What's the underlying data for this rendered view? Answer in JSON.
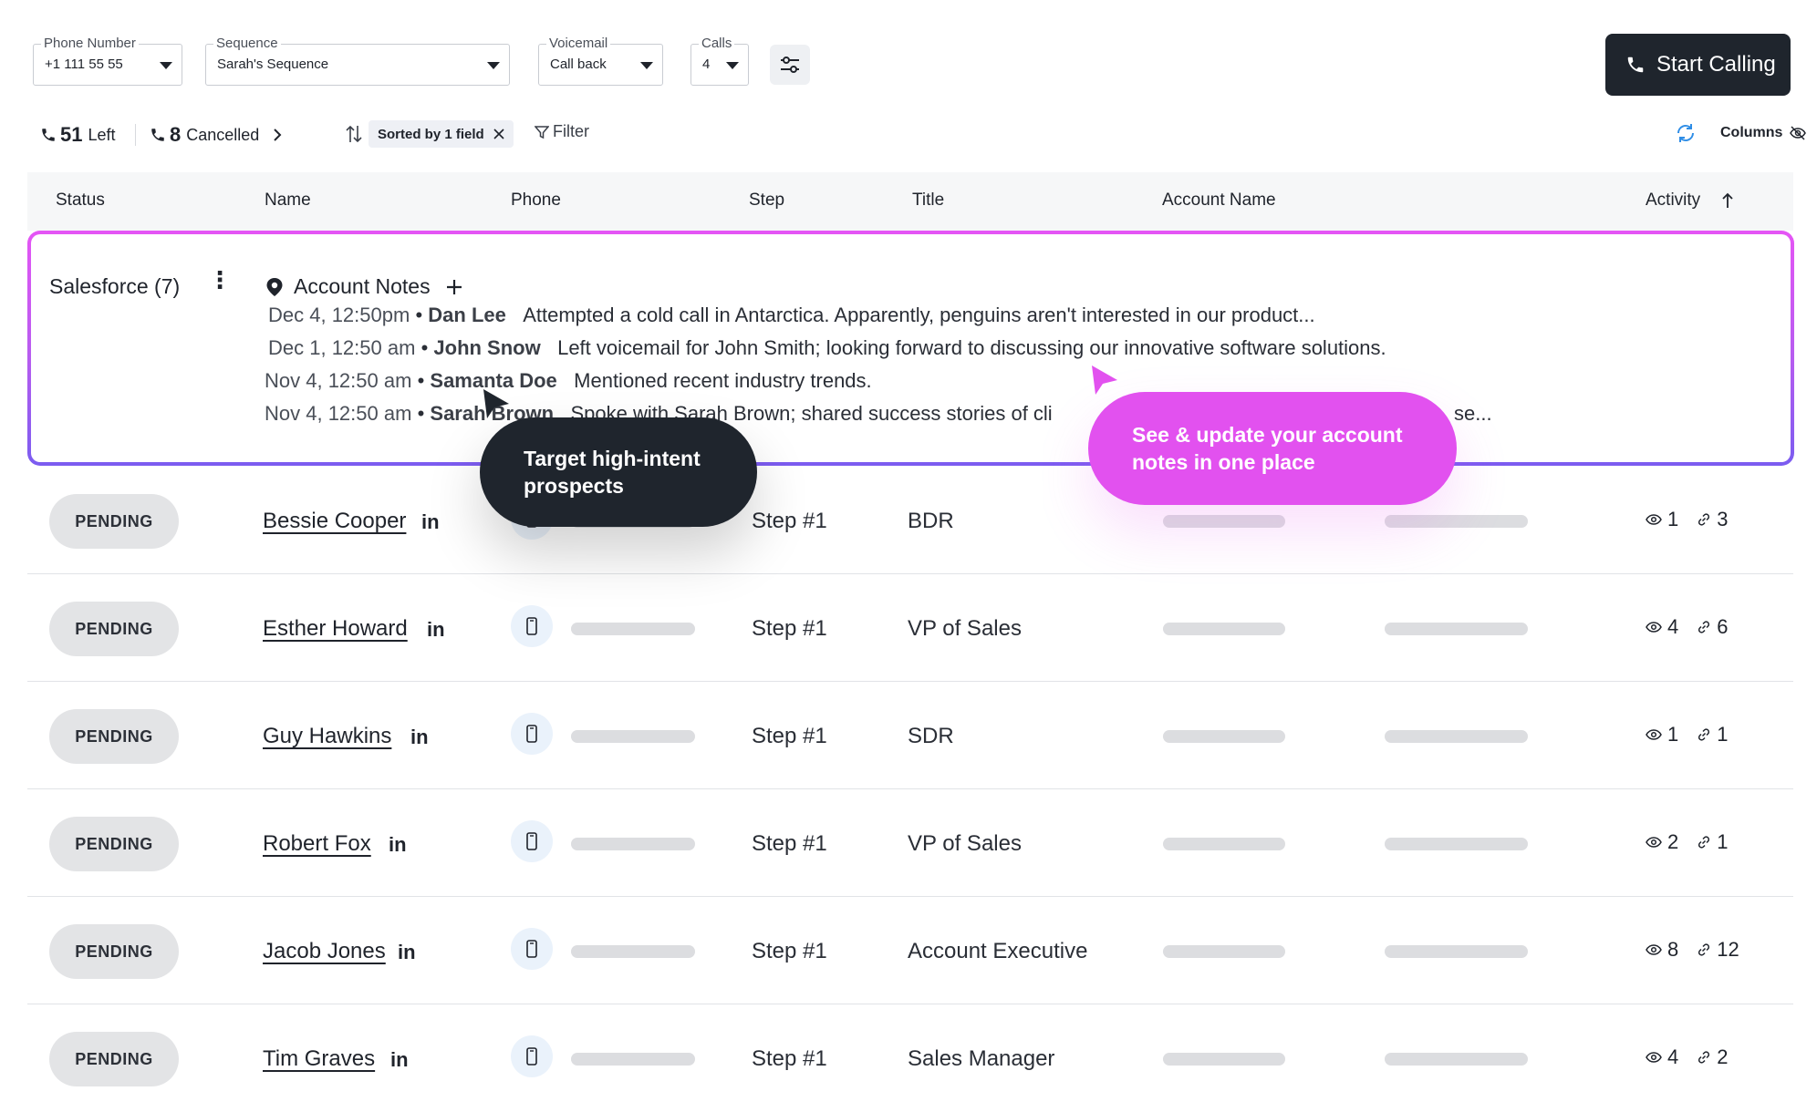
{
  "filters": {
    "phone_number": {
      "label": "Phone Number",
      "value": "+1 111 55 55"
    },
    "sequence": {
      "label": "Sequence",
      "value": "Sarah's Sequence"
    },
    "voicemail": {
      "label": "Voicemail",
      "value": "Call back"
    },
    "calls": {
      "label": "Calls",
      "value": "4"
    }
  },
  "start_button": {
    "label": "Start Calling"
  },
  "stats": {
    "left_count": "51",
    "left_label": "Left",
    "cancelled_count": "8",
    "cancelled_label": "Cancelled"
  },
  "sort": {
    "label": "Sorted by 1 field"
  },
  "filter": {
    "label": "Filter"
  },
  "columns": {
    "label": "Columns"
  },
  "table": {
    "headers": {
      "status": "Status",
      "name": "Name",
      "phone": "Phone",
      "step": "Step",
      "title": "Title",
      "account_name": "Account Name",
      "activity": "Activity"
    }
  },
  "salesforce": {
    "label": "Salesforce (7)",
    "notes_title": "Account Notes",
    "notes": [
      {
        "timestamp": "Dec 4, 12:50pm",
        "author": "Dan Lee",
        "text": "Attempted a cold call in Antarctica. Apparently, penguins aren't interested in our product..."
      },
      {
        "timestamp": "Dec 1, 12:50 am",
        "author": "John Snow",
        "text": "Left voicemail for John Smith; looking forward to discussing our innovative software solutions."
      },
      {
        "timestamp": "Nov 4, 12:50 am",
        "author": "Samanta Doe",
        "text": "Mentioned recent industry trends."
      },
      {
        "timestamp": "Nov 4, 12:50 am",
        "author": "Sarah Brown",
        "text": "Spoke with Sarah Brown; shared success stories of cli",
        "tail": "se..."
      }
    ]
  },
  "callouts": {
    "dark": "Target high-intent prospects",
    "pink": "See & update your account notes in one place"
  },
  "rows": [
    {
      "status": "PENDING",
      "name": "Bessie Cooper",
      "step": "Step #1",
      "title": "BDR",
      "views": "1",
      "links": "3"
    },
    {
      "status": "PENDING",
      "name": "Esther Howard",
      "step": "Step #1",
      "title": "VP of Sales",
      "views": "4",
      "links": "6"
    },
    {
      "status": "PENDING",
      "name": "Guy Hawkins",
      "step": "Step #1",
      "title": "SDR",
      "views": "1",
      "links": "1"
    },
    {
      "status": "PENDING",
      "name": "Robert Fox",
      "step": "Step #1",
      "title": "VP of Sales",
      "views": "2",
      "links": "1"
    },
    {
      "status": "PENDING",
      "name": "Jacob Jones",
      "step": "Step #1",
      "title": "Account Executive",
      "views": "8",
      "links": "12"
    },
    {
      "status": "PENDING",
      "name": "Tim Graves",
      "step": "Step #1",
      "title": "Sales Manager",
      "views": "4",
      "links": "2"
    }
  ],
  "icons": {
    "linkedin": "in",
    "phone": "phone-icon",
    "mobile": "mobile-phone-icon",
    "eye": "eye-icon",
    "link": "link-icon"
  },
  "colors": {
    "primary_dark": "#1f252d",
    "accent_pink": "#e251ef",
    "panel_gradient_start": "#e555f5",
    "panel_gradient_end": "#7b5cf0",
    "refresh_blue": "#2e8de6"
  }
}
